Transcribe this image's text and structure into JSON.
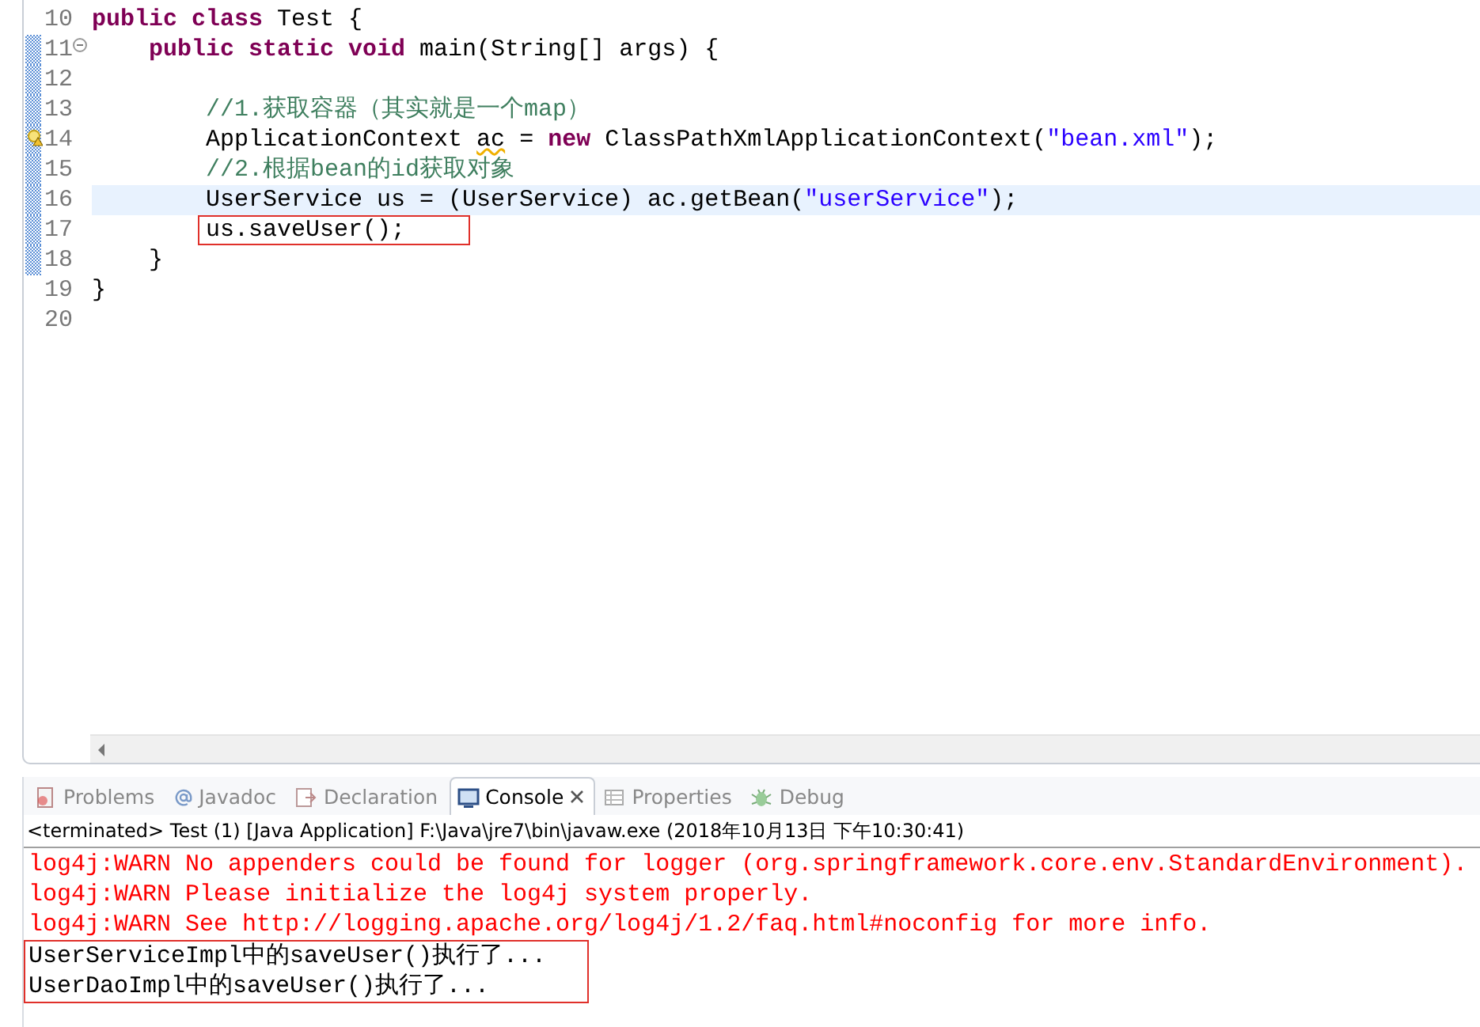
{
  "editor": {
    "lines": [
      {
        "number": "10",
        "fold": false,
        "warning": false,
        "changed": false,
        "current": false,
        "boxed": false,
        "tokens": [
          {
            "kind": "keyword",
            "text": "public class"
          },
          {
            "kind": "plain",
            "text": " Test {"
          }
        ]
      },
      {
        "number": "11",
        "fold": true,
        "warning": false,
        "changed": true,
        "current": false,
        "boxed": false,
        "tokens": [
          {
            "kind": "keyword",
            "text": "    public static void"
          },
          {
            "kind": "plain",
            "text": " main(String[] args) {"
          }
        ]
      },
      {
        "number": "12",
        "fold": false,
        "warning": false,
        "changed": true,
        "current": false,
        "boxed": false
      },
      {
        "number": "13",
        "fold": false,
        "warning": false,
        "changed": true,
        "current": false,
        "boxed": false,
        "tokens": [
          {
            "kind": "comment",
            "text": "        //1.获取容器（其实就是一个map）"
          }
        ]
      },
      {
        "number": "14",
        "fold": false,
        "warning": true,
        "changed": true,
        "current": false,
        "boxed": false,
        "tokens": [
          {
            "kind": "plain",
            "text": "        ApplicationContext "
          },
          {
            "kind": "squiggle",
            "text": "ac"
          },
          {
            "kind": "plain",
            "text": " = "
          },
          {
            "kind": "keyword",
            "text": "new"
          },
          {
            "kind": "plain",
            "text": " ClassPathXmlApplicationContext("
          },
          {
            "kind": "string",
            "text": "\"bean.xml\""
          },
          {
            "kind": "plain",
            "text": ");"
          }
        ]
      },
      {
        "number": "15",
        "fold": false,
        "warning": false,
        "changed": true,
        "current": false,
        "boxed": false,
        "tokens": [
          {
            "kind": "comment",
            "text": "        //2.根据bean的id获取对象"
          }
        ]
      },
      {
        "number": "16",
        "fold": false,
        "warning": false,
        "changed": true,
        "current": true,
        "boxed": false,
        "tokens": [
          {
            "kind": "plain",
            "text": "        UserService us = (UserService) ac.getBean("
          },
          {
            "kind": "string",
            "text": "\"userService\""
          },
          {
            "kind": "plain",
            "text": ");"
          }
        ]
      },
      {
        "number": "17",
        "fold": false,
        "warning": false,
        "changed": true,
        "current": false,
        "boxed": true,
        "tokens": [
          {
            "kind": "plain",
            "text": "        us.saveUser();"
          }
        ]
      },
      {
        "number": "18",
        "fold": false,
        "warning": false,
        "changed": true,
        "current": false,
        "boxed": false,
        "tokens": [
          {
            "kind": "plain",
            "text": "    }"
          }
        ]
      },
      {
        "number": "19",
        "fold": false,
        "warning": false,
        "changed": false,
        "current": false,
        "boxed": false,
        "tokens": [
          {
            "kind": "plain",
            "text": "}"
          }
        ]
      },
      {
        "number": "20",
        "fold": false,
        "warning": false,
        "changed": false,
        "current": false,
        "boxed": false
      }
    ]
  },
  "tabs": [
    {
      "label": "Problems",
      "kind": "problems",
      "selected": false
    },
    {
      "label": "Javadoc",
      "kind": "javadoc",
      "selected": false
    },
    {
      "label": "Declaration",
      "kind": "declaration",
      "selected": false
    },
    {
      "label": "Console",
      "kind": "console",
      "selected": true
    },
    {
      "label": "Properties",
      "kind": "properties",
      "selected": false
    },
    {
      "label": "Debug",
      "kind": "debug",
      "selected": false
    }
  ],
  "console": {
    "status": "<terminated> Test (1) [Java Application] F:\\Java\\jre7\\bin\\javaw.exe (2018年10月13日 下午10:30:41)",
    "lines": [
      {
        "kind": "error",
        "boxed": false,
        "text": "log4j:WARN No appenders could be found for logger (org.springframework.core.env.StandardEnvironment)."
      },
      {
        "kind": "error",
        "boxed": false,
        "text": "log4j:WARN Please initialize the log4j system properly."
      },
      {
        "kind": "error",
        "boxed": false,
        "text": "log4j:WARN See http://logging.apache.org/log4j/1.2/faq.html#noconfig for more info."
      },
      {
        "kind": "output",
        "boxed": true,
        "text": "UserServiceImpl中的saveUser()执行了..."
      },
      {
        "kind": "output",
        "boxed": true,
        "text": "UserDaoImpl中的saveUser()执行了..."
      }
    ]
  }
}
